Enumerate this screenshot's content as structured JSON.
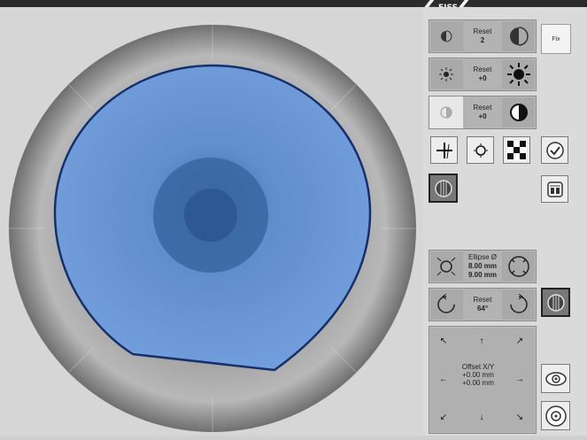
{
  "brand": {
    "logo_text": "Z...Z"
  },
  "fix_label": "Fix",
  "controls": {
    "row1": {
      "label": "Reset",
      "value": "2"
    },
    "row2": {
      "label": "Reset",
      "value": "+0"
    },
    "row3": {
      "label": "Reset",
      "value": "+0"
    },
    "ellipse": {
      "label": "Ellipse Ø",
      "line1": "8.00 mm",
      "line2": "9.00 mm"
    },
    "rotation": {
      "label": "Reset",
      "value": "64°"
    },
    "offset": {
      "label": "Offset X/Y",
      "line1": "+0.00 mm",
      "line2": "+0.00 mm"
    }
  },
  "colors": {
    "overlay": "#5b8fd6",
    "outline": "#15306b",
    "panel": "#a9a9a9"
  }
}
